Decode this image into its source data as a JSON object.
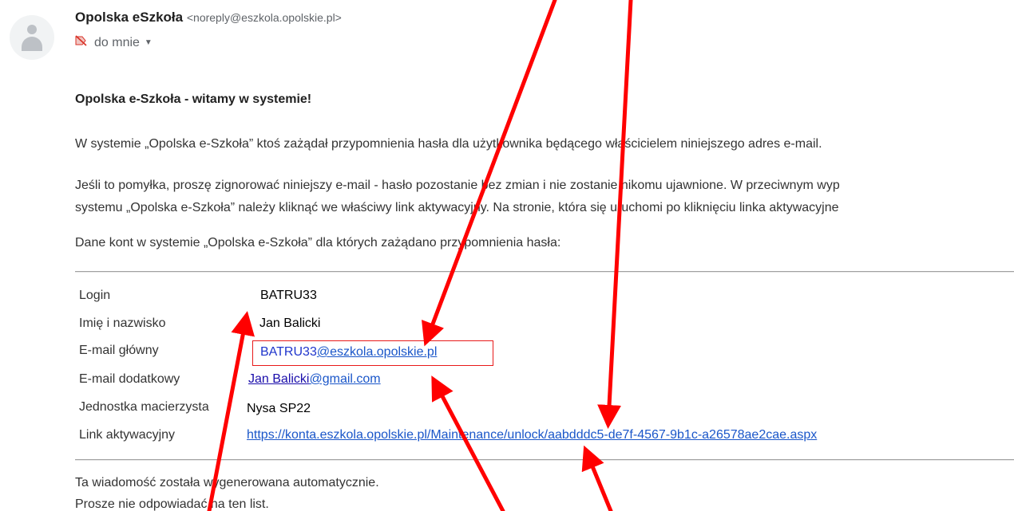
{
  "sender": {
    "name": "Opolska eSzkoła",
    "email": "<noreply@eszkola.opolskie.pl>"
  },
  "recipient": {
    "label": "do mnie"
  },
  "message": {
    "heading": "Opolska e-Szkoła - witamy w systemie!",
    "para1": "W systemie „Opolska e-Szkoła” ktoś zażądał przypomnienia hasła dla użytkownika będącego właścicielem niniejszego adres e-mail.",
    "para2_line1": "Jeśli to pomyłka, proszę zignorować niniejszy e-mail - hasło pozostanie bez zmian i nie zostanie nikomu ujawnione. W przeciwnym wyp",
    "para2_line2": "systemu „Opolska e-Szkoła” należy kliknąć we właściwy link aktywacyjny. Na stronie, która się uruchomi po kliknięciu linka aktywacyjne",
    "para3": "Dane kont w systemie „Opolska e-Szkoła” dla których zażądano przypomnienia hasła:"
  },
  "account": {
    "rows": [
      {
        "label": "Login",
        "value": "BATRU33"
      },
      {
        "label": "Imię i nazwisko",
        "value": "Jan Balicki"
      },
      {
        "label": "E-mail główny",
        "value_prefix": "BATRU33",
        "value_domain": "@eszkola.opolskie.pl"
      },
      {
        "label": "E-mail dodatkowy",
        "value_prefix": "Jan Balicki",
        "value_domain": "@gmail.com"
      },
      {
        "label": "Jednostka macierzysta",
        "value": "Nysa SP22"
      },
      {
        "label": "Link aktywacyjny",
        "value": "https://konta.eszkola.opolskie.pl/Maintenance/unlock/aabdddc5-de7f-4567-9b1c-a26578ae2cae.aspx"
      }
    ]
  },
  "footer": {
    "line1": "Ta wiadomość została wygenerowana automatycznie.",
    "line2": "Prosze nie odpowiadać na ten list."
  },
  "colors": {
    "annotation_arrow": "#ff0000",
    "link": "#1a56c9"
  },
  "icons": {
    "avatar": "person-avatar-icon",
    "recipient": "no-entry-tag-icon",
    "caret": "caret-down-icon"
  }
}
